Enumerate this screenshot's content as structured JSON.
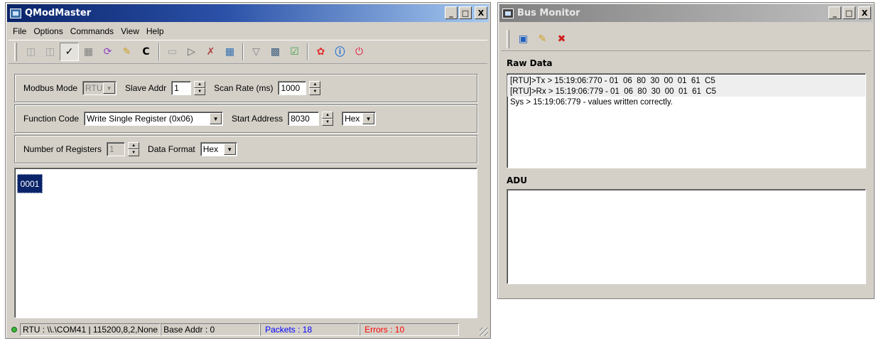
{
  "main_window": {
    "title": "QModMaster",
    "title_controls": [
      "_",
      "□",
      "X"
    ],
    "menu": [
      "File",
      "Options",
      "Commands",
      "View",
      "Help"
    ],
    "toolbar_icons": [
      "connect-icon",
      "disconnect-icon",
      "serial-icon",
      "tcp-icon",
      "reset-counters-icon",
      "clear-icon",
      "refresh-icon",
      "read-write-icon",
      "scan-icon",
      "bus-monitor-icon",
      "tools-icon",
      "settings-icon",
      "log-icon",
      "debug-icon",
      "help-icon",
      "about-icon",
      "exit-icon"
    ],
    "modbus_mode_label": "Modbus Mode",
    "modbus_mode_value": "RTU",
    "slave_addr_label": "Slave Addr",
    "slave_addr_value": "1",
    "scan_rate_label": "Scan Rate (ms)",
    "scan_rate_value": "1000",
    "function_code_label": "Function Code",
    "function_code_value": "Write Single Register (0x06)",
    "start_address_label": "Start Address",
    "start_address_value": "8030",
    "start_address_format": "Hex",
    "num_registers_label": "Number of Registers",
    "num_registers_value": "1",
    "data_format_label": "Data Format",
    "data_format_value": "Hex",
    "registers": [
      "0001"
    ],
    "status": {
      "connection": "RTU : \\\\.\\COM41 | 115200,8,2,None",
      "base_addr": "Base Addr : 0",
      "packets": "Packets : 18",
      "errors": "Errors : 10",
      "packets_color": "#0000ff",
      "errors_color": "#ff0000"
    }
  },
  "bus_monitor": {
    "title": "Bus Monitor",
    "title_controls": [
      "_",
      "□",
      "X"
    ],
    "raw_data_label": "Raw Data",
    "raw_data_lines": [
      "[RTU]>Tx > 15:19:06:770 - 01  06  80  30  00  01  61  C5",
      "[RTU]>Rx > 15:19:06:779 - 01  06  80  30  00  01  61  C5",
      "Sys > 15:19:06:779 - values written correctly."
    ],
    "adu_label": "ADU"
  }
}
